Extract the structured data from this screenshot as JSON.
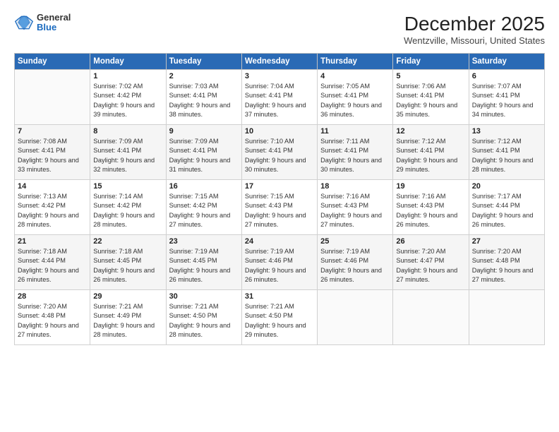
{
  "header": {
    "logo_general": "General",
    "logo_blue": "Blue",
    "title": "December 2025",
    "location": "Wentzville, Missouri, United States"
  },
  "weekdays": [
    "Sunday",
    "Monday",
    "Tuesday",
    "Wednesday",
    "Thursday",
    "Friday",
    "Saturday"
  ],
  "weeks": [
    [
      {
        "day": "",
        "sunrise": "",
        "sunset": "",
        "daylight": ""
      },
      {
        "day": "1",
        "sunrise": "Sunrise: 7:02 AM",
        "sunset": "Sunset: 4:42 PM",
        "daylight": "Daylight: 9 hours and 39 minutes."
      },
      {
        "day": "2",
        "sunrise": "Sunrise: 7:03 AM",
        "sunset": "Sunset: 4:41 PM",
        "daylight": "Daylight: 9 hours and 38 minutes."
      },
      {
        "day": "3",
        "sunrise": "Sunrise: 7:04 AM",
        "sunset": "Sunset: 4:41 PM",
        "daylight": "Daylight: 9 hours and 37 minutes."
      },
      {
        "day": "4",
        "sunrise": "Sunrise: 7:05 AM",
        "sunset": "Sunset: 4:41 PM",
        "daylight": "Daylight: 9 hours and 36 minutes."
      },
      {
        "day": "5",
        "sunrise": "Sunrise: 7:06 AM",
        "sunset": "Sunset: 4:41 PM",
        "daylight": "Daylight: 9 hours and 35 minutes."
      },
      {
        "day": "6",
        "sunrise": "Sunrise: 7:07 AM",
        "sunset": "Sunset: 4:41 PM",
        "daylight": "Daylight: 9 hours and 34 minutes."
      }
    ],
    [
      {
        "day": "7",
        "sunrise": "Sunrise: 7:08 AM",
        "sunset": "Sunset: 4:41 PM",
        "daylight": "Daylight: 9 hours and 33 minutes."
      },
      {
        "day": "8",
        "sunrise": "Sunrise: 7:09 AM",
        "sunset": "Sunset: 4:41 PM",
        "daylight": "Daylight: 9 hours and 32 minutes."
      },
      {
        "day": "9",
        "sunrise": "Sunrise: 7:09 AM",
        "sunset": "Sunset: 4:41 PM",
        "daylight": "Daylight: 9 hours and 31 minutes."
      },
      {
        "day": "10",
        "sunrise": "Sunrise: 7:10 AM",
        "sunset": "Sunset: 4:41 PM",
        "daylight": "Daylight: 9 hours and 30 minutes."
      },
      {
        "day": "11",
        "sunrise": "Sunrise: 7:11 AM",
        "sunset": "Sunset: 4:41 PM",
        "daylight": "Daylight: 9 hours and 30 minutes."
      },
      {
        "day": "12",
        "sunrise": "Sunrise: 7:12 AM",
        "sunset": "Sunset: 4:41 PM",
        "daylight": "Daylight: 9 hours and 29 minutes."
      },
      {
        "day": "13",
        "sunrise": "Sunrise: 7:12 AM",
        "sunset": "Sunset: 4:41 PM",
        "daylight": "Daylight: 9 hours and 28 minutes."
      }
    ],
    [
      {
        "day": "14",
        "sunrise": "Sunrise: 7:13 AM",
        "sunset": "Sunset: 4:42 PM",
        "daylight": "Daylight: 9 hours and 28 minutes."
      },
      {
        "day": "15",
        "sunrise": "Sunrise: 7:14 AM",
        "sunset": "Sunset: 4:42 PM",
        "daylight": "Daylight: 9 hours and 28 minutes."
      },
      {
        "day": "16",
        "sunrise": "Sunrise: 7:15 AM",
        "sunset": "Sunset: 4:42 PM",
        "daylight": "Daylight: 9 hours and 27 minutes."
      },
      {
        "day": "17",
        "sunrise": "Sunrise: 7:15 AM",
        "sunset": "Sunset: 4:43 PM",
        "daylight": "Daylight: 9 hours and 27 minutes."
      },
      {
        "day": "18",
        "sunrise": "Sunrise: 7:16 AM",
        "sunset": "Sunset: 4:43 PM",
        "daylight": "Daylight: 9 hours and 27 minutes."
      },
      {
        "day": "19",
        "sunrise": "Sunrise: 7:16 AM",
        "sunset": "Sunset: 4:43 PM",
        "daylight": "Daylight: 9 hours and 26 minutes."
      },
      {
        "day": "20",
        "sunrise": "Sunrise: 7:17 AM",
        "sunset": "Sunset: 4:44 PM",
        "daylight": "Daylight: 9 hours and 26 minutes."
      }
    ],
    [
      {
        "day": "21",
        "sunrise": "Sunrise: 7:18 AM",
        "sunset": "Sunset: 4:44 PM",
        "daylight": "Daylight: 9 hours and 26 minutes."
      },
      {
        "day": "22",
        "sunrise": "Sunrise: 7:18 AM",
        "sunset": "Sunset: 4:45 PM",
        "daylight": "Daylight: 9 hours and 26 minutes."
      },
      {
        "day": "23",
        "sunrise": "Sunrise: 7:19 AM",
        "sunset": "Sunset: 4:45 PM",
        "daylight": "Daylight: 9 hours and 26 minutes."
      },
      {
        "day": "24",
        "sunrise": "Sunrise: 7:19 AM",
        "sunset": "Sunset: 4:46 PM",
        "daylight": "Daylight: 9 hours and 26 minutes."
      },
      {
        "day": "25",
        "sunrise": "Sunrise: 7:19 AM",
        "sunset": "Sunset: 4:46 PM",
        "daylight": "Daylight: 9 hours and 26 minutes."
      },
      {
        "day": "26",
        "sunrise": "Sunrise: 7:20 AM",
        "sunset": "Sunset: 4:47 PM",
        "daylight": "Daylight: 9 hours and 27 minutes."
      },
      {
        "day": "27",
        "sunrise": "Sunrise: 7:20 AM",
        "sunset": "Sunset: 4:48 PM",
        "daylight": "Daylight: 9 hours and 27 minutes."
      }
    ],
    [
      {
        "day": "28",
        "sunrise": "Sunrise: 7:20 AM",
        "sunset": "Sunset: 4:48 PM",
        "daylight": "Daylight: 9 hours and 27 minutes."
      },
      {
        "day": "29",
        "sunrise": "Sunrise: 7:21 AM",
        "sunset": "Sunset: 4:49 PM",
        "daylight": "Daylight: 9 hours and 28 minutes."
      },
      {
        "day": "30",
        "sunrise": "Sunrise: 7:21 AM",
        "sunset": "Sunset: 4:50 PM",
        "daylight": "Daylight: 9 hours and 28 minutes."
      },
      {
        "day": "31",
        "sunrise": "Sunrise: 7:21 AM",
        "sunset": "Sunset: 4:50 PM",
        "daylight": "Daylight: 9 hours and 29 minutes."
      },
      {
        "day": "",
        "sunrise": "",
        "sunset": "",
        "daylight": ""
      },
      {
        "day": "",
        "sunrise": "",
        "sunset": "",
        "daylight": ""
      },
      {
        "day": "",
        "sunrise": "",
        "sunset": "",
        "daylight": ""
      }
    ]
  ]
}
